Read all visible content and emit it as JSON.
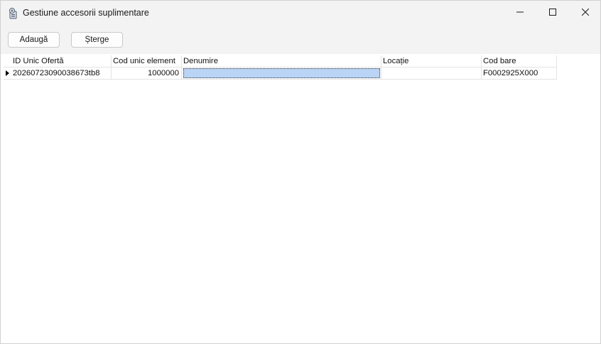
{
  "window": {
    "title": "Gestiune accesorii suplimentare",
    "app_icon": "app-icon",
    "controls": [
      "minimize-icon",
      "maximize-icon",
      "close-icon"
    ]
  },
  "toolbar": {
    "add_label": "Adaugă",
    "delete_label": "Șterge"
  },
  "grid": {
    "columns": [
      "ID Unic Ofertă",
      "Cod unic element",
      "Denumire",
      "Locație",
      "Cod bare"
    ],
    "rows": [
      {
        "id_unic_oferta": "20260723090038673tb8",
        "cod_unic_element": "1000000",
        "denumire": "",
        "locatie": "",
        "cod_bare": "F0002925X000"
      }
    ],
    "selection_color": "#b9d4f5"
  }
}
